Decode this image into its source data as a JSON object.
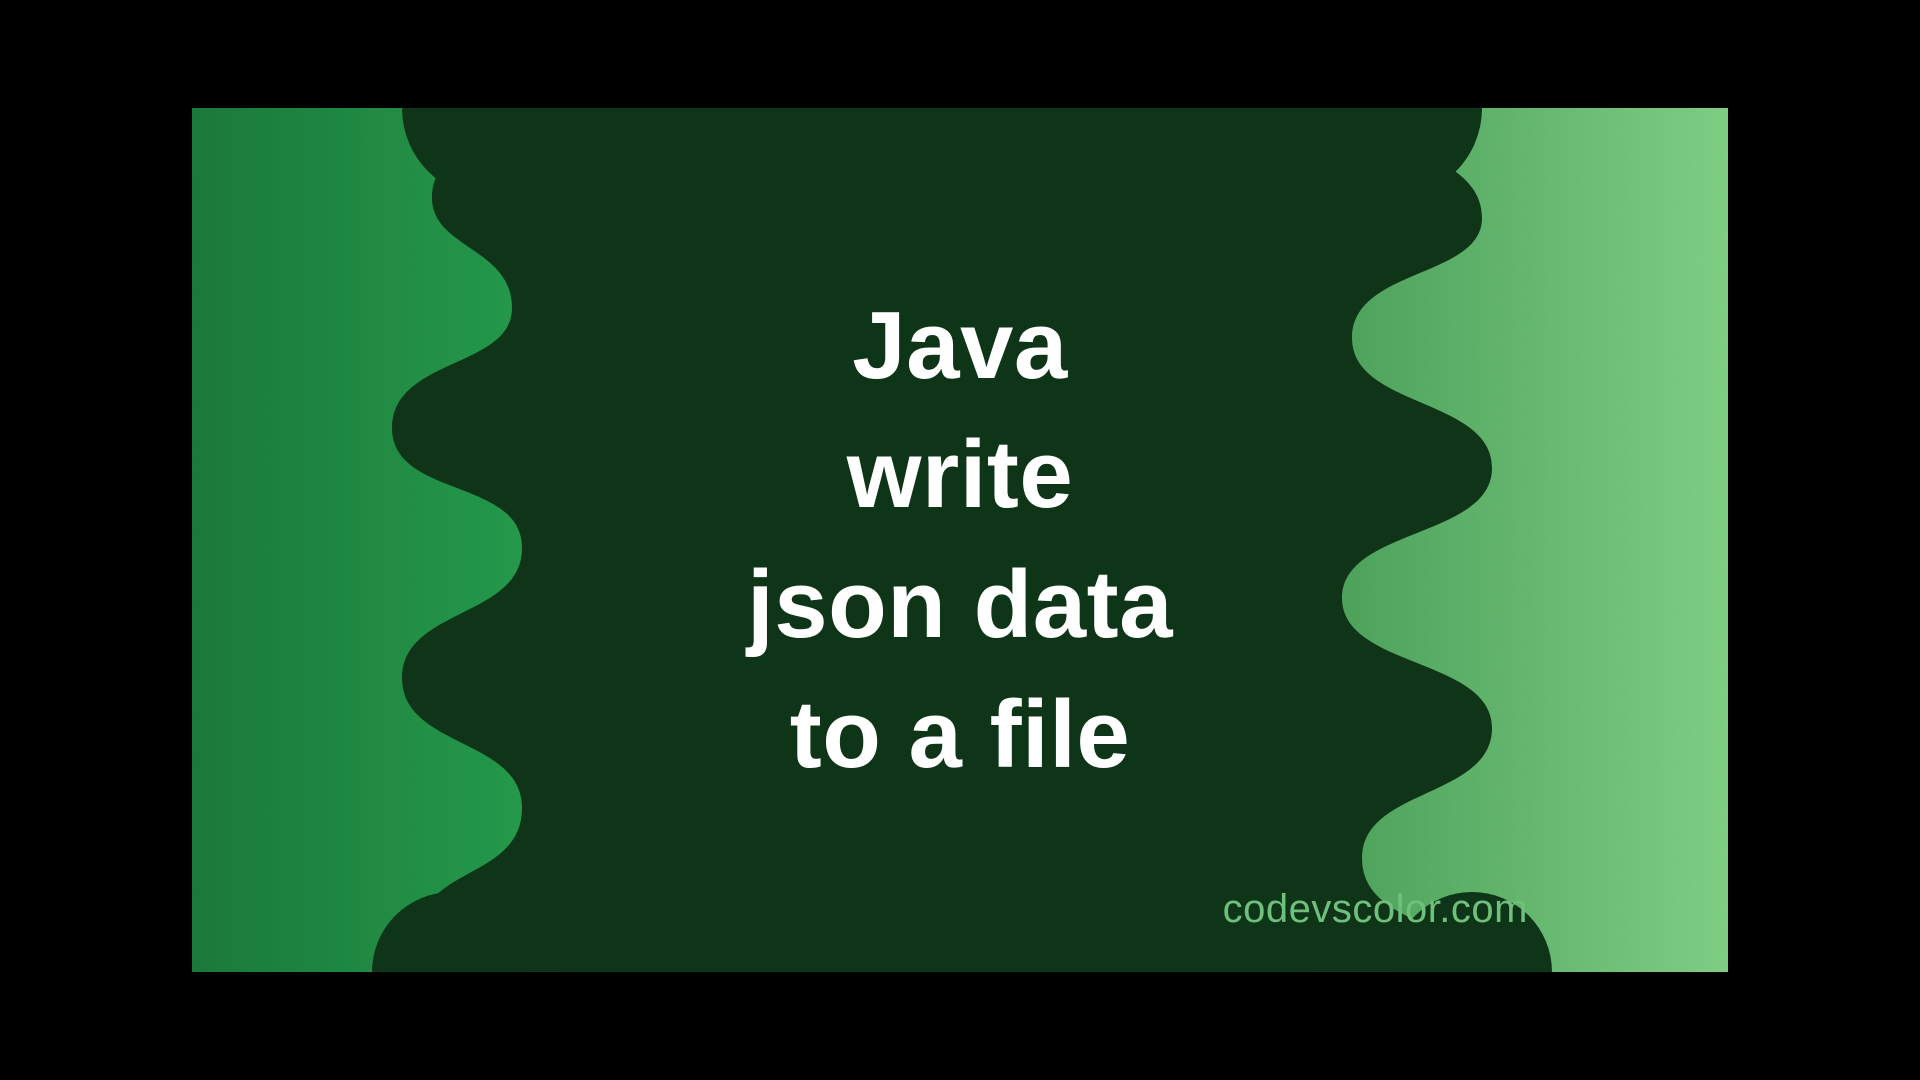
{
  "title_lines": "Java\nwrite\njson data\nto a file",
  "attribution": "codevscolor.com",
  "colors": {
    "bg_dark": "#0f3518",
    "left_green": "#1f8c43",
    "right_green_a": "#6ec273",
    "right_green_b": "#4ea35c",
    "title": "#ffffff",
    "attribution": "#6fbf7d"
  }
}
